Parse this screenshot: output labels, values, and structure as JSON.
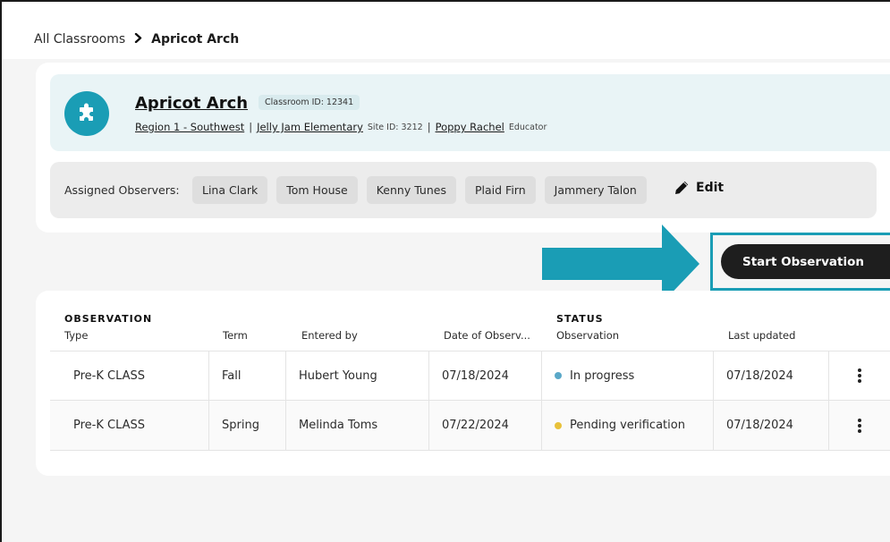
{
  "breadcrumb": {
    "root": "All Classrooms",
    "current": "Apricot Arch"
  },
  "classroom": {
    "name": "Apricot Arch",
    "id_label": "Classroom ID: 12341",
    "region": "Region 1 - Southwest",
    "school": "Jelly Jam Elementary",
    "site_id": "Site ID: 3212",
    "educator_name": "Poppy Rachel",
    "educator_role": "Educator",
    "separator": "|"
  },
  "observers": {
    "label": "Assigned Observers:",
    "chips": [
      "Lina Clark",
      "Tom House",
      "Kenny Tunes",
      "Plaid Firn",
      "Jammery Talon"
    ],
    "edit_label": "Edit"
  },
  "actions": {
    "start_label": "Start Observation"
  },
  "table": {
    "group_observation": "OBSERVATION",
    "group_status": "STATUS",
    "columns": {
      "type": "Type",
      "term": "Term",
      "entered_by": "Entered by",
      "date": "Date of Observ...",
      "observation": "Observation",
      "last_updated": "Last updated"
    },
    "rows": [
      {
        "type": "Pre-K CLASS",
        "term": "Fall",
        "entered_by": "Hubert Young",
        "date": "07/18/2024",
        "status": "In progress",
        "last_updated": "07/18/2024"
      },
      {
        "type": "Pre-K CLASS",
        "term": "Spring",
        "entered_by": "Melinda Toms",
        "date": "07/22/2024",
        "status": "Pending verification",
        "last_updated": "07/18/2024"
      }
    ]
  },
  "colors": {
    "accent": "#1a9db5",
    "status_in_progress": "#5aa8c8",
    "status_pending": "#e8c13a",
    "button_dark": "#1e1e1e"
  },
  "icons": {
    "avatar": "puzzle-icon",
    "edit": "pencil-icon",
    "breadcrumb_sep": "chevron-right-icon",
    "row_menu": "kebab-icon",
    "callout": "arrow-right-icon"
  }
}
